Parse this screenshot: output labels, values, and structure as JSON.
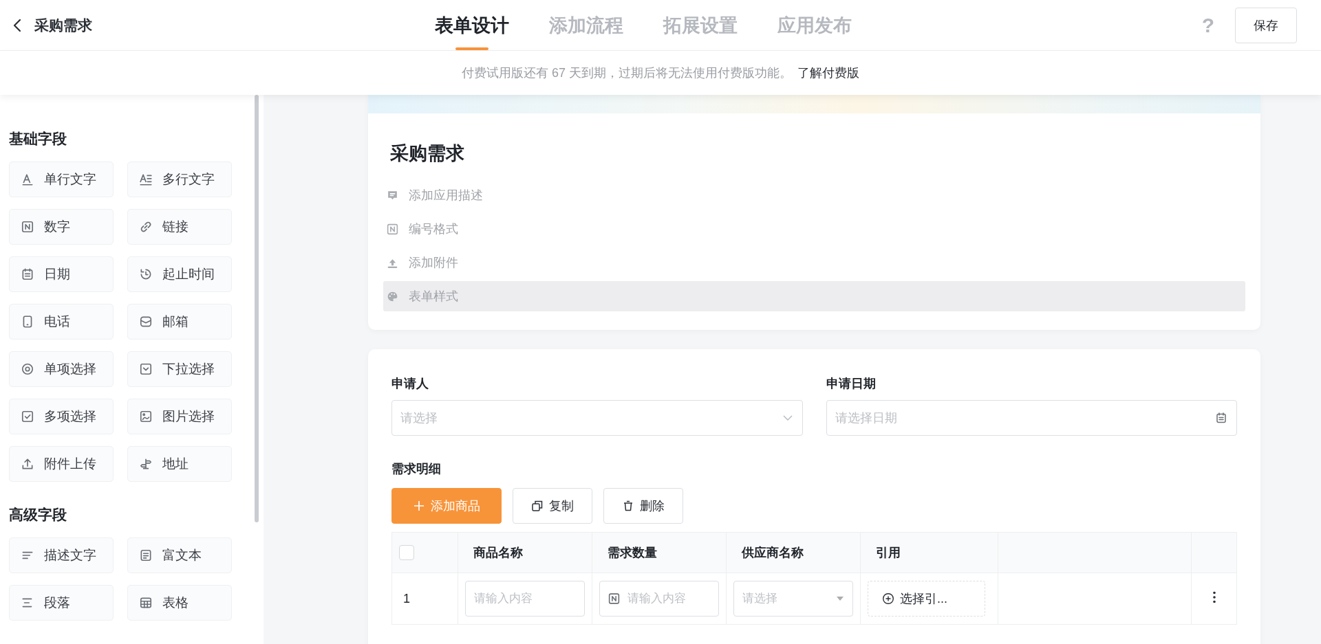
{
  "header": {
    "title": "采购需求",
    "tabs": [
      {
        "label": "表单设计",
        "selected": true
      },
      {
        "label": "添加流程",
        "selected": false
      },
      {
        "label": "拓展设置",
        "selected": false
      },
      {
        "label": "应用发布",
        "selected": false
      }
    ],
    "help": "?",
    "save_button": "保存"
  },
  "notice": {
    "text": "付费试用版还有 67 天到期，过期后将无法使用付费版功能。",
    "link": "了解付费版"
  },
  "sidebar": {
    "groups": [
      {
        "title": "基础字段",
        "items": [
          {
            "label": "单行文字"
          },
          {
            "label": "多行文字"
          },
          {
            "label": "数字"
          },
          {
            "label": "链接"
          },
          {
            "label": "日期"
          },
          {
            "label": "起止时间"
          },
          {
            "label": "电话"
          },
          {
            "label": "邮箱"
          },
          {
            "label": "单项选择"
          },
          {
            "label": "下拉选择"
          },
          {
            "label": "多项选择"
          },
          {
            "label": "图片选择"
          },
          {
            "label": "附件上传"
          },
          {
            "label": "地址"
          }
        ]
      },
      {
        "title": "高级字段",
        "items": [
          {
            "label": "描述文字"
          },
          {
            "label": "富文本"
          },
          {
            "label": "段落"
          },
          {
            "label": "表格"
          }
        ]
      }
    ]
  },
  "form_header": {
    "title": "采购需求",
    "items": [
      {
        "label": "添加应用描述",
        "selected": false
      },
      {
        "label": "编号格式",
        "selected": false
      },
      {
        "label": "添加附件",
        "selected": false
      },
      {
        "label": "表单样式",
        "selected": true
      }
    ]
  },
  "form": {
    "fields": [
      {
        "label": "申请人",
        "placeholder": "请选择",
        "kind": "select"
      },
      {
        "label": "申请日期",
        "placeholder": "请选择日期",
        "kind": "date"
      }
    ],
    "detail": {
      "title": "需求明细",
      "buttons": [
        {
          "label": "添加商品",
          "kind": "primary"
        },
        {
          "label": "复制",
          "kind": "copy"
        },
        {
          "label": "删除",
          "kind": "delete"
        }
      ],
      "table": {
        "select_all_checked": false,
        "columns": [
          "商品名称",
          "需求数量",
          "供应商名称",
          "引用"
        ],
        "rows": [
          {
            "index": "1",
            "cells": [
              {
                "kind": "text",
                "placeholder": "请输入内容"
              },
              {
                "kind": "number",
                "placeholder": "请输入内容"
              },
              {
                "kind": "select",
                "placeholder": "请选择"
              },
              {
                "kind": "reference",
                "label": "选择引..."
              }
            ]
          }
        ]
      }
    }
  }
}
